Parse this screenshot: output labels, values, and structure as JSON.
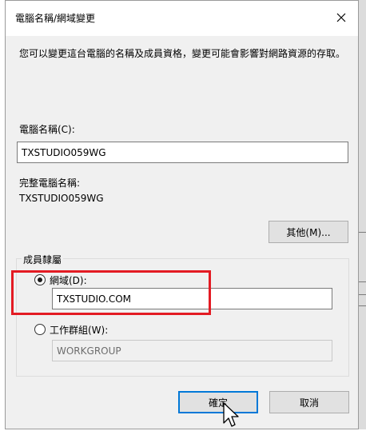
{
  "dialog": {
    "title": "電腦名稱/網域變更",
    "description": "您可以變更這台電腦的名稱及成員資格，變更可能會影響對網路資源的存取。",
    "computer_name_label": "電腦名稱(C):",
    "computer_name_value": "TXSTUDIO059WG",
    "full_name_label": "完整電腦名稱:",
    "full_name_value": "TXSTUDIO059WG",
    "more_button": "其他(M)...",
    "member_group_label": "成員隸屬",
    "domain_radio_label": "網域(D):",
    "domain_value": "TXSTUDIO.COM",
    "workgroup_radio_label": "工作群組(W):",
    "workgroup_value": "WORKGROUP",
    "selected_membership": "domain",
    "ok_button": "確定",
    "cancel_button": "取消"
  },
  "colors": {
    "highlight_box": "#e31b23",
    "primary_button_border": "#0078d7"
  }
}
